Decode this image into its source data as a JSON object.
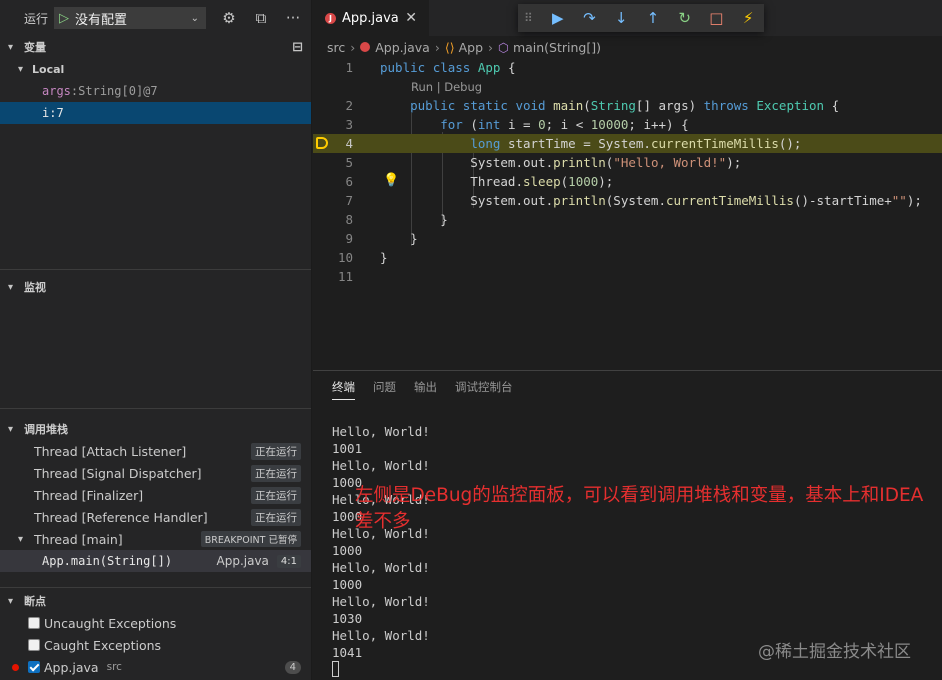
{
  "sidebar": {
    "run_label": "运行",
    "config_name": "没有配置",
    "sections": {
      "variables": "变量",
      "watch": "监视",
      "call_stack": "调用堆栈",
      "breakpoints": "断点"
    },
    "local_scope": "Local",
    "variables": [
      {
        "name": "args",
        "value": "String[0]@7"
      },
      {
        "name": "i",
        "value": "7"
      }
    ],
    "threads": [
      {
        "name": "Thread [Attach Listener]",
        "status": "正在运行"
      },
      {
        "name": "Thread [Signal Dispatcher]",
        "status": "正在运行"
      },
      {
        "name": "Thread [Finalizer]",
        "status": "正在运行"
      },
      {
        "name": "Thread [Reference Handler]",
        "status": "正在运行"
      }
    ],
    "main_thread": {
      "name": "Thread [main]",
      "status": "BREAKPOINT 已暂停"
    },
    "frame": {
      "name": "App.main(String[])",
      "file": "App.java",
      "pos": "4:1"
    },
    "breakpoints": [
      {
        "label": "Uncaught Exceptions",
        "checked": false
      },
      {
        "label": "Caught Exceptions",
        "checked": false
      }
    ],
    "bp_file": {
      "label": "App.java",
      "folder": "src",
      "line": "4"
    }
  },
  "editor": {
    "tab_label": "App.java",
    "breadcrumb": [
      "src",
      "App.java",
      "App",
      "main(String[])"
    ],
    "codelens": "Run | Debug",
    "line_numbers": [
      "1",
      "2",
      "3",
      "4",
      "5",
      "6",
      "7",
      "8",
      "9",
      "10",
      "11"
    ]
  },
  "panel": {
    "tabs": [
      "终端",
      "问题",
      "输出",
      "调试控制台"
    ],
    "terminal_lines": [
      "Hello, World!",
      "1001",
      "Hello, World!",
      "1000",
      "Hello, World!",
      "1000",
      "Hello, World!",
      "1000",
      "Hello, World!",
      "1000",
      "Hello, World!",
      "1030",
      "Hello, World!",
      "1041"
    ]
  },
  "annotation": "左侧是DeBug的监控面板，可以看到调用堆栈和变量，基本上和IDEA差不多",
  "watermark": "@稀土掘金技术社区",
  "colors": {
    "sidebar_bg": "#252526",
    "editor_bg": "#1e1e1e",
    "current_line": "#4b4b18",
    "selection": "#094771",
    "annotation": "#e52f2f"
  }
}
